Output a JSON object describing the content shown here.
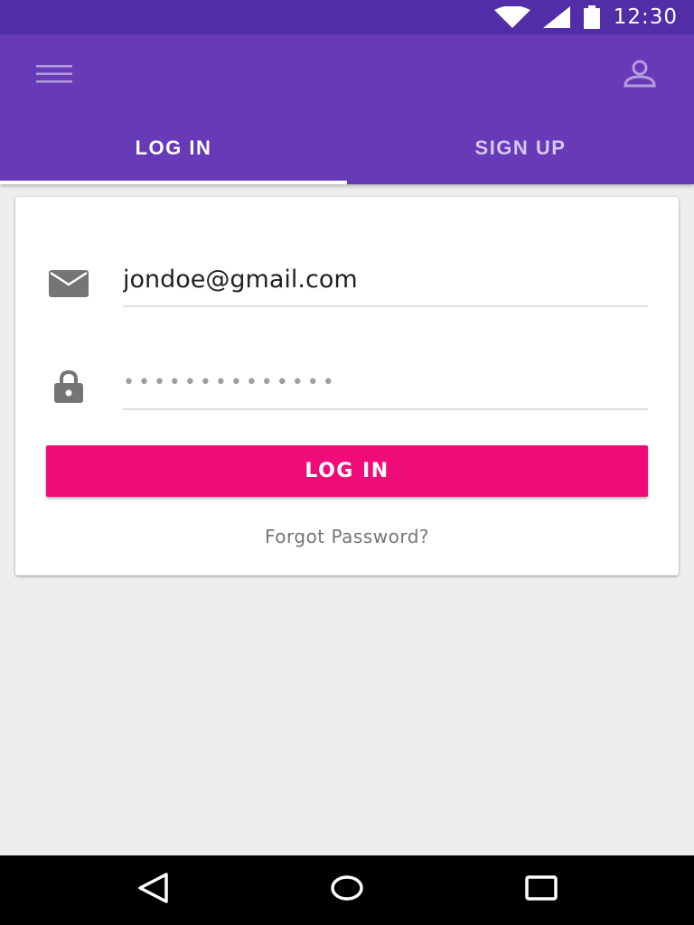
{
  "status_bar": {
    "time": "12:30",
    "icons": [
      "wifi-icon",
      "signal-icon",
      "battery-icon"
    ]
  },
  "app_bar": {
    "menu_icon": "hamburger-menu-icon",
    "profile_icon": "person-icon",
    "tabs": [
      {
        "label": "LOG IN",
        "active": true
      },
      {
        "label": "SIGN UP",
        "active": false
      }
    ]
  },
  "login_form": {
    "email": {
      "icon": "mail-icon",
      "value": "jondoe@gmail.com"
    },
    "password": {
      "icon": "lock-icon",
      "value": "••••••••••••••"
    },
    "submit_label": "LOG IN",
    "forgot_label": "Forgot Password?"
  },
  "nav_bar": {
    "icons": [
      "back-icon",
      "home-icon",
      "recents-icon"
    ]
  },
  "colors": {
    "status_bar": "#512da8",
    "app_bar": "#673ab7",
    "accent": "#f00c78",
    "background": "#eeeeee"
  }
}
